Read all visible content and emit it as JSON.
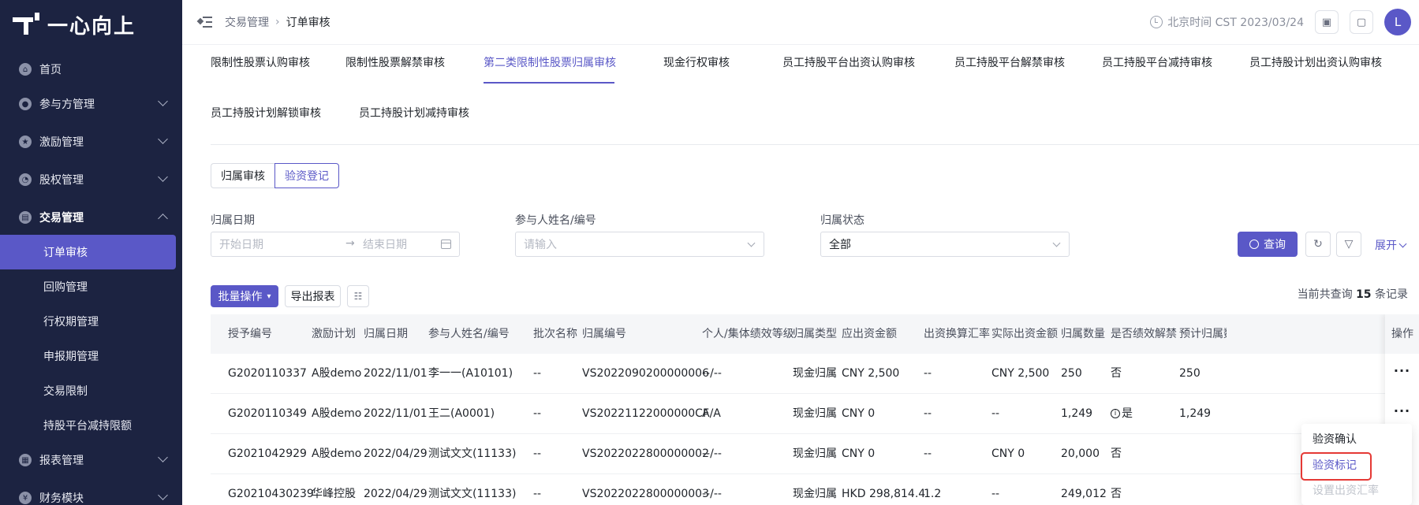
{
  "app": {
    "logo_text": "一心向上"
  },
  "sidebar": {
    "items": [
      {
        "label": "首页",
        "icon": "home-icon"
      },
      {
        "label": "参与方管理",
        "icon": "users-icon"
      },
      {
        "label": "激励管理",
        "icon": "star-icon"
      },
      {
        "label": "股权管理",
        "icon": "pie-icon"
      },
      {
        "label": "交易管理",
        "icon": "trade-icon"
      },
      {
        "label": "报表管理",
        "icon": "report-icon"
      },
      {
        "label": "财务模块",
        "icon": "finance-icon"
      }
    ],
    "sub_items": [
      "订单审核",
      "回购管理",
      "行权期管理",
      "申报期管理",
      "交易限制",
      "持股平台减持限额"
    ]
  },
  "header": {
    "breadcrumb": [
      "交易管理",
      "订单审核"
    ],
    "time_text": "北京时间 CST 2023/03/24",
    "avatar": "L"
  },
  "tabs": [
    "限制性股票认购审核",
    "限制性股票解禁审核",
    "第二类限制性股票归属审核",
    "现金行权审核",
    "员工持股平台出资认购审核",
    "员工持股平台解禁审核",
    "员工持股平台减持审核",
    "员工持股计划出资认购审核",
    "员工持股计划解锁审核",
    "员工持股计划减持审核"
  ],
  "segment": [
    "归属审核",
    "验资登记"
  ],
  "filters": {
    "date_label": "归属日期",
    "date_start": "开始日期",
    "date_end": "结束日期",
    "name_label": "参与人姓名/编号",
    "name_placeholder": "请输入",
    "status_label": "归属状态",
    "status_value": "全部"
  },
  "actions": {
    "query": "查询",
    "expand": "展开",
    "batch": "批量操作",
    "export": "导出报表"
  },
  "record": {
    "prefix": "当前共查询",
    "count": "15",
    "suffix": "条记录"
  },
  "table": {
    "headers": [
      "授予编号",
      "激励计划",
      "归属日期",
      "参与人姓名/编号",
      "批次名称",
      "归属编号",
      "个人/集体绩效等级",
      "归属类型",
      "应出资金额",
      "出资换算汇率",
      "实际出资金额",
      "归属数量",
      "是否绩效解禁",
      "预计归属数",
      "操作"
    ],
    "rows": [
      [
        "G2020110337",
        "A股demo",
        "2022/11/01",
        "李一一(A10101)",
        "--",
        "VS2022090200000006",
        "--/--",
        "现金归属",
        "CNY 2,500",
        "--",
        "CNY 2,500",
        "250",
        "否",
        "250"
      ],
      [
        "G2020110349",
        "A股demo",
        "2022/11/01",
        "王二(A0001)",
        "--",
        "VS20221122000000CF",
        "A/A",
        "现金归属",
        "CNY 0",
        "--",
        "--",
        "1,249",
        "是",
        "1,249"
      ],
      [
        "G2021042929",
        "A股demo",
        "2022/04/29",
        "测试文文(11133)",
        "--",
        "VS2022022800000002",
        "--/--",
        "现金归属",
        "CNY 0",
        "--",
        "CNY 0",
        "20,000",
        "否",
        ""
      ],
      [
        "G20210430239",
        "华峰控股",
        "2022/04/29",
        "测试文文(11133)",
        "--",
        "VS2022022800000003",
        "--/--",
        "现金归属",
        "HKD 298,814.4",
        "1.2",
        "--",
        "249,012",
        "否",
        ""
      ]
    ],
    "more": "···"
  },
  "dropdown": [
    "验资确认",
    "验资标记",
    "设置出资汇率"
  ]
}
